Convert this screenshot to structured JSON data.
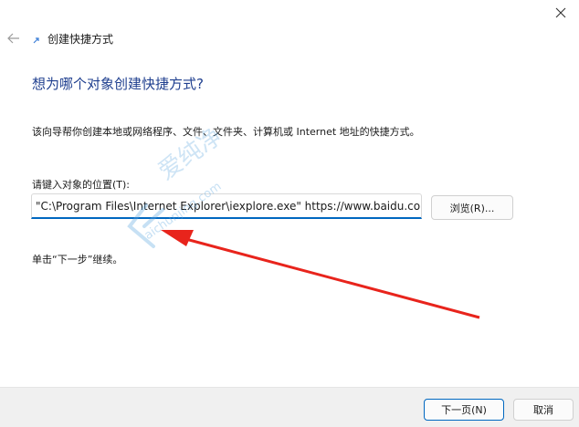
{
  "window": {
    "title": "创建快捷方式",
    "close_label": "Close"
  },
  "wizard": {
    "question": "想为哪个对象创建快捷方式?",
    "description": "该向导帮你创建本地或网络程序、文件、文件夹、计算机或 Internet 地址的快捷方式。",
    "location_label": "请键入对象的位置(T):",
    "location_value": "\"C:\\Program Files\\Internet Explorer\\iexplore.exe\" https://www.baidu.com/",
    "browse_label": "浏览(R)...",
    "hint": "单击“下一步”继续。"
  },
  "footer": {
    "next_label": "下一页(N)",
    "cancel_label": "取消"
  },
  "watermark": {
    "text": "爱纯净",
    "url": "aichunjing.com"
  },
  "colors": {
    "accent": "#0067c0",
    "question": "#1f3f8f",
    "annotation": "#e8241c"
  }
}
